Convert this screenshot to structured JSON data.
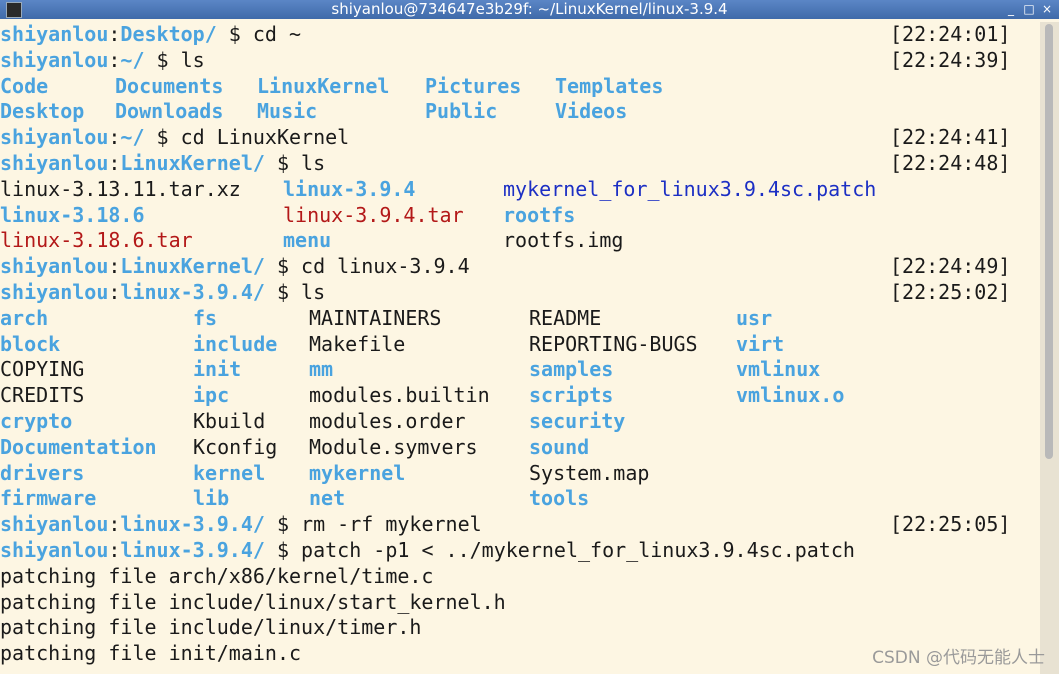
{
  "window": {
    "title": "shiyanlou@734647e3b29f: ~/LinuxKernel/linux-3.9.4",
    "controls": [
      "_",
      "□",
      "×"
    ]
  },
  "prompts": [
    {
      "user": "shiyanlou",
      "path": "Desktop/",
      "cmd": "cd ~",
      "time": "[22:24:01]"
    },
    {
      "user": "shiyanlou",
      "path": "~/",
      "cmd": "ls",
      "time": "[22:24:39]"
    },
    {
      "user": "shiyanlou",
      "path": "~/",
      "cmd": "cd LinuxKernel",
      "time": "[22:24:41]"
    },
    {
      "user": "shiyanlou",
      "path": "LinuxKernel/",
      "cmd": "ls",
      "time": "[22:24:48]"
    },
    {
      "user": "shiyanlou",
      "path": "LinuxKernel/",
      "cmd": "cd linux-3.9.4",
      "time": "[22:24:49]"
    },
    {
      "user": "shiyanlou",
      "path": "linux-3.9.4/",
      "cmd": "ls",
      "time": "[22:25:02]"
    },
    {
      "user": "shiyanlou",
      "path": "linux-3.9.4/",
      "cmd": "rm -rf mykernel",
      "time": "[22:25:05]"
    },
    {
      "user": "shiyanlou",
      "path": "linux-3.9.4/",
      "cmd": "patch -p1 < ../mykernel_for_linux3.9.4sc.patch",
      "time": ""
    }
  ],
  "home_ls": [
    [
      "Code",
      "Documents",
      "LinuxKernel",
      "Pictures",
      "Templates"
    ],
    [
      "Desktop",
      "Downloads",
      "Music",
      "Public",
      "Videos"
    ]
  ],
  "lk_ls": [
    [
      [
        "linux-3.13.11.tar.xz",
        "file"
      ],
      [
        "linux-3.9.4",
        "dir"
      ],
      [
        "mykernel_for_linux3.9.4sc.patch",
        "patch"
      ]
    ],
    [
      [
        "linux-3.18.6",
        "dir"
      ],
      [
        "linux-3.9.4.tar",
        "arc"
      ],
      [
        "rootfs",
        "dir"
      ]
    ],
    [
      [
        "linux-3.18.6.tar",
        "arc"
      ],
      [
        "menu",
        "dir"
      ],
      [
        "rootfs.img",
        "file"
      ]
    ]
  ],
  "kernel_ls": [
    [
      [
        "arch",
        "dir"
      ],
      [
        "fs",
        "dir"
      ],
      [
        "MAINTAINERS",
        "file"
      ],
      [
        "README",
        "file"
      ],
      [
        "usr",
        "dir"
      ]
    ],
    [
      [
        "block",
        "dir"
      ],
      [
        "include",
        "dir"
      ],
      [
        "Makefile",
        "file"
      ],
      [
        "REPORTING-BUGS",
        "file"
      ],
      [
        "virt",
        "dir"
      ]
    ],
    [
      [
        "COPYING",
        "file"
      ],
      [
        "init",
        "dir"
      ],
      [
        "mm",
        "dir"
      ],
      [
        "samples",
        "dir"
      ],
      [
        "vmlinux",
        "dir"
      ]
    ],
    [
      [
        "CREDITS",
        "file"
      ],
      [
        "ipc",
        "dir"
      ],
      [
        "modules.builtin",
        "file"
      ],
      [
        "scripts",
        "dir"
      ],
      [
        "vmlinux.o",
        "dir"
      ]
    ],
    [
      [
        "crypto",
        "dir"
      ],
      [
        "Kbuild",
        "file"
      ],
      [
        "modules.order",
        "file"
      ],
      [
        "security",
        "dir"
      ],
      [
        "",
        ""
      ]
    ],
    [
      [
        "Documentation",
        "dir"
      ],
      [
        "Kconfig",
        "file"
      ],
      [
        "Module.symvers",
        "file"
      ],
      [
        "sound",
        "dir"
      ],
      [
        "",
        ""
      ]
    ],
    [
      [
        "drivers",
        "dir"
      ],
      [
        "kernel",
        "dir"
      ],
      [
        "mykernel",
        "dir"
      ],
      [
        "System.map",
        "file"
      ],
      [
        "",
        ""
      ]
    ],
    [
      [
        "firmware",
        "dir"
      ],
      [
        "lib",
        "dir"
      ],
      [
        "net",
        "dir"
      ],
      [
        "tools",
        "dir"
      ],
      [
        "",
        ""
      ]
    ]
  ],
  "patch_output": [
    "patching file arch/x86/kernel/time.c",
    "patching file include/linux/start_kernel.h",
    "patching file include/linux/timer.h",
    "patching file init/main.c"
  ],
  "watermark": "CSDN @代码无能人士",
  "colors": {
    "dir": "#4aa3df",
    "archive": "#b31818",
    "patch": "#1c2fc4",
    "background": "#fdf6e3"
  }
}
